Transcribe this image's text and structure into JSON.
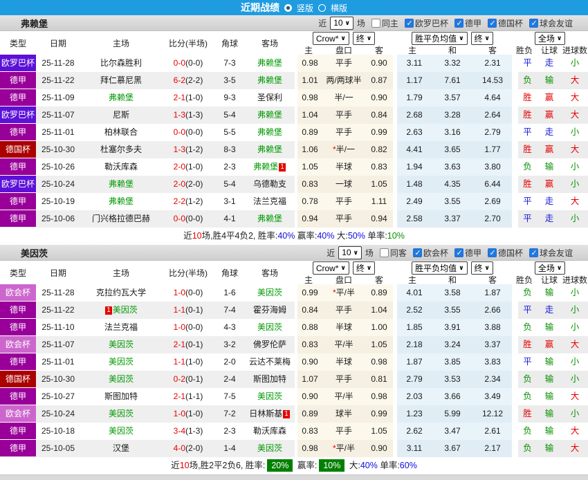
{
  "topbar": {
    "title": "近期战绩",
    "options": [
      {
        "label": "竖版",
        "selected": true
      },
      {
        "label": "横版",
        "selected": false
      }
    ]
  },
  "colors": {
    "topbar_blue": "#1f9ce0",
    "europa_league": "#5c10d8",
    "bundesliga": "#990099",
    "dfb_pokal": "#aa0000",
    "conference_league": "#cc66cc",
    "win_red": "#e60000",
    "draw_blue": "#1414dc",
    "lose_green": "#089000",
    "focus_team_green": "#009900",
    "summary_badge_green": "#008000"
  },
  "sections": [
    {
      "team": "弗赖堡",
      "filter": {
        "prefix": "近",
        "count": "10",
        "suffix": "场",
        "same": {
          "label": "同主",
          "checked": false
        },
        "competitions": [
          {
            "label": "欧罗巴杯",
            "checked": true
          },
          {
            "label": "德甲",
            "checked": true
          },
          {
            "label": "德国杯",
            "checked": true
          },
          {
            "label": "球会友谊",
            "checked": true
          }
        ]
      },
      "header": {
        "type": "类型",
        "date": "日期",
        "home": "主场",
        "score": "比分(半场)",
        "corner": "角球",
        "away": "客场",
        "odds_source": "Crow*",
        "odds_stage": "终",
        "odds_cols": [
          "主",
          "盘口",
          "客"
        ],
        "mean_source": "胜平负均值",
        "mean_stage": "终",
        "mean_cols": [
          "主",
          "和",
          "客"
        ],
        "scope": "全场",
        "result_cols": [
          "胜负",
          "让球",
          "进球数"
        ]
      },
      "rows": [
        {
          "type": "欧罗巴杯",
          "tc": "europa",
          "date": "25-11-28",
          "home": {
            "t": "比尔森胜利",
            "f": false
          },
          "score": "0-0",
          "half": "(0-0)",
          "corner": "7-3",
          "away": {
            "t": "弗赖堡",
            "f": true
          },
          "o1": "0.98",
          "hc": "平手",
          "o2": "0.90",
          "m1": "3.11",
          "m2": "3.32",
          "m3": "2.31",
          "res": [
            [
              "平",
              "b"
            ],
            [
              "走",
              "b"
            ],
            [
              "小",
              "g"
            ]
          ]
        },
        {
          "type": "德甲",
          "tc": "bundesliga",
          "date": "25-11-22",
          "home": {
            "t": "拜仁慕尼黑",
            "f": false
          },
          "score": "6-2",
          "half": "(2-2)",
          "corner": "3-5",
          "away": {
            "t": "弗赖堡",
            "f": true
          },
          "o1": "1.01",
          "hc": "两/两球半",
          "o2": "0.87",
          "m1": "1.17",
          "m2": "7.61",
          "m3": "14.53",
          "res": [
            [
              "负",
              "g"
            ],
            [
              "输",
              "g"
            ],
            [
              "大",
              "r"
            ]
          ]
        },
        {
          "type": "德甲",
          "tc": "bundesliga",
          "date": "25-11-09",
          "home": {
            "t": "弗赖堡",
            "f": true
          },
          "score": "2-1",
          "half": "(1-0)",
          "corner": "9-3",
          "away": {
            "t": "圣保利",
            "f": false
          },
          "o1": "0.98",
          "hc": "半/一",
          "o2": "0.90",
          "m1": "1.79",
          "m2": "3.57",
          "m3": "4.64",
          "res": [
            [
              "胜",
              "r"
            ],
            [
              "赢",
              "r"
            ],
            [
              "大",
              "r"
            ]
          ]
        },
        {
          "type": "欧罗巴杯",
          "tc": "europa",
          "date": "25-11-07",
          "home": {
            "t": "尼斯",
            "f": false
          },
          "score": "1-3",
          "half": "(1-3)",
          "corner": "5-4",
          "away": {
            "t": "弗赖堡",
            "f": true
          },
          "o1": "1.04",
          "hc": "平手",
          "o2": "0.84",
          "m1": "2.68",
          "m2": "3.28",
          "m3": "2.64",
          "res": [
            [
              "胜",
              "r"
            ],
            [
              "赢",
              "r"
            ],
            [
              "大",
              "r"
            ]
          ]
        },
        {
          "type": "德甲",
          "tc": "bundesliga",
          "date": "25-11-01",
          "home": {
            "t": "柏林联合",
            "f": false
          },
          "score": "0-0",
          "half": "(0-0)",
          "corner": "5-5",
          "away": {
            "t": "弗赖堡",
            "f": true
          },
          "o1": "0.89",
          "hc": "平手",
          "o2": "0.99",
          "m1": "2.63",
          "m2": "3.16",
          "m3": "2.79",
          "res": [
            [
              "平",
              "b"
            ],
            [
              "走",
              "b"
            ],
            [
              "小",
              "g"
            ]
          ]
        },
        {
          "type": "德国杯",
          "tc": "pokal",
          "date": "25-10-30",
          "home": {
            "t": "杜塞尔多夫",
            "f": false
          },
          "score": "1-3",
          "half": "(1-2)",
          "corner": "8-3",
          "away": {
            "t": "弗赖堡",
            "f": true
          },
          "o1": "1.06",
          "hc": "*半/一",
          "o2": "0.82",
          "m1": "4.41",
          "m2": "3.65",
          "m3": "1.77",
          "res": [
            [
              "胜",
              "r"
            ],
            [
              "赢",
              "r"
            ],
            [
              "大",
              "r"
            ]
          ]
        },
        {
          "type": "德甲",
          "tc": "bundesliga",
          "date": "25-10-26",
          "home": {
            "t": "勒沃库森",
            "f": false
          },
          "score": "2-0",
          "half": "(1-0)",
          "corner": "2-3",
          "away": {
            "t": "弗赖堡",
            "f": true,
            "badge": "1",
            "side": "right"
          },
          "o1": "1.05",
          "hc": "半球",
          "o2": "0.83",
          "m1": "1.94",
          "m2": "3.63",
          "m3": "3.80",
          "res": [
            [
              "负",
              "g"
            ],
            [
              "输",
              "g"
            ],
            [
              "小",
              "g"
            ]
          ]
        },
        {
          "type": "欧罗巴杯",
          "tc": "europa",
          "date": "25-10-24",
          "home": {
            "t": "弗赖堡",
            "f": true
          },
          "score": "2-0",
          "half": "(2-0)",
          "corner": "5-4",
          "away": {
            "t": "乌德勒支",
            "f": false
          },
          "o1": "0.83",
          "hc": "一球",
          "o2": "1.05",
          "m1": "1.48",
          "m2": "4.35",
          "m3": "6.44",
          "res": [
            [
              "胜",
              "r"
            ],
            [
              "赢",
              "r"
            ],
            [
              "小",
              "g"
            ]
          ]
        },
        {
          "type": "德甲",
          "tc": "bundesliga",
          "date": "25-10-19",
          "home": {
            "t": "弗赖堡",
            "f": true
          },
          "score": "2-2",
          "half": "(1-2)",
          "corner": "3-1",
          "away": {
            "t": "法兰克福",
            "f": false
          },
          "o1": "0.78",
          "hc": "平手",
          "o2": "1.11",
          "m1": "2.49",
          "m2": "3.55",
          "m3": "2.69",
          "res": [
            [
              "平",
              "b"
            ],
            [
              "走",
              "b"
            ],
            [
              "大",
              "r"
            ]
          ]
        },
        {
          "type": "德甲",
          "tc": "bundesliga",
          "date": "25-10-06",
          "home": {
            "t": "门兴格拉德巴赫",
            "f": false
          },
          "score": "0-0",
          "half": "(0-0)",
          "corner": "4-1",
          "away": {
            "t": "弗赖堡",
            "f": true
          },
          "o1": "0.94",
          "hc": "平手",
          "o2": "0.94",
          "m1": "2.58",
          "m2": "3.37",
          "m3": "2.70",
          "res": [
            [
              "平",
              "b"
            ],
            [
              "走",
              "b"
            ],
            [
              "小",
              "g"
            ]
          ]
        }
      ],
      "summary": [
        [
          "近",
          "k"
        ],
        [
          "10",
          "r"
        ],
        [
          "场,胜4平4负2, 胜率:",
          "k"
        ],
        [
          "40%",
          "b"
        ],
        [
          " 赢率:",
          "k"
        ],
        [
          "40%",
          "b"
        ],
        [
          " 大:",
          "k"
        ],
        [
          "50%",
          "b"
        ],
        [
          " 单率:",
          "k"
        ],
        [
          "10%",
          "g"
        ]
      ]
    },
    {
      "team": "美因茨",
      "filter": {
        "prefix": "近",
        "count": "10",
        "suffix": "场",
        "same": {
          "label": "同客",
          "checked": false
        },
        "competitions": [
          {
            "label": "欧会杯",
            "checked": true
          },
          {
            "label": "德甲",
            "checked": true
          },
          {
            "label": "德国杯",
            "checked": true
          },
          {
            "label": "球会友谊",
            "checked": true
          }
        ]
      },
      "header": {
        "type": "类型",
        "date": "日期",
        "home": "主场",
        "score": "比分(半场)",
        "corner": "角球",
        "away": "客场",
        "odds_source": "Crow*",
        "odds_stage": "终",
        "odds_cols": [
          "主",
          "盘口",
          "客"
        ],
        "mean_source": "胜平负均值",
        "mean_stage": "终",
        "mean_cols": [
          "主",
          "和",
          "客"
        ],
        "scope": "全场",
        "result_cols": [
          "胜负",
          "让球",
          "进球数"
        ]
      },
      "rows": [
        {
          "type": "欧会杯",
          "tc": "conference",
          "date": "25-11-28",
          "home": {
            "t": "克拉约瓦大学",
            "f": false
          },
          "score": "1-0",
          "half": "(0-0)",
          "corner": "1-6",
          "away": {
            "t": "美因茨",
            "f": true
          },
          "o1": "0.99",
          "hc": "*平/半",
          "o2": "0.89",
          "m1": "4.01",
          "m2": "3.58",
          "m3": "1.87",
          "res": [
            [
              "负",
              "g"
            ],
            [
              "输",
              "g"
            ],
            [
              "小",
              "g"
            ]
          ]
        },
        {
          "type": "德甲",
          "tc": "bundesliga",
          "date": "25-11-22",
          "home": {
            "t": "美因茨",
            "f": true,
            "badge": "1",
            "side": "left"
          },
          "score": "1-1",
          "half": "(0-1)",
          "corner": "7-4",
          "away": {
            "t": "霍芬海姆",
            "f": false
          },
          "o1": "0.84",
          "hc": "平手",
          "o2": "1.04",
          "m1": "2.52",
          "m2": "3.55",
          "m3": "2.66",
          "res": [
            [
              "平",
              "b"
            ],
            [
              "走",
              "b"
            ],
            [
              "小",
              "g"
            ]
          ]
        },
        {
          "type": "德甲",
          "tc": "bundesliga",
          "date": "25-11-10",
          "home": {
            "t": "法兰克福",
            "f": false
          },
          "score": "1-0",
          "half": "(0-0)",
          "corner": "4-3",
          "away": {
            "t": "美因茨",
            "f": true
          },
          "o1": "0.88",
          "hc": "半球",
          "o2": "1.00",
          "m1": "1.85",
          "m2": "3.91",
          "m3": "3.88",
          "res": [
            [
              "负",
              "g"
            ],
            [
              "输",
              "g"
            ],
            [
              "小",
              "g"
            ]
          ]
        },
        {
          "type": "欧会杯",
          "tc": "conference",
          "date": "25-11-07",
          "home": {
            "t": "美因茨",
            "f": true
          },
          "score": "2-1",
          "half": "(0-1)",
          "corner": "3-2",
          "away": {
            "t": "佛罗伦萨",
            "f": false
          },
          "o1": "0.83",
          "hc": "平/半",
          "o2": "1.05",
          "m1": "2.18",
          "m2": "3.24",
          "m3": "3.37",
          "res": [
            [
              "胜",
              "r"
            ],
            [
              "赢",
              "r"
            ],
            [
              "大",
              "r"
            ]
          ]
        },
        {
          "type": "德甲",
          "tc": "bundesliga",
          "date": "25-11-01",
          "home": {
            "t": "美因茨",
            "f": true
          },
          "score": "1-1",
          "half": "(1-0)",
          "corner": "2-0",
          "away": {
            "t": "云达不莱梅",
            "f": false
          },
          "o1": "0.90",
          "hc": "半球",
          "o2": "0.98",
          "m1": "1.87",
          "m2": "3.85",
          "m3": "3.83",
          "res": [
            [
              "平",
              "b"
            ],
            [
              "输",
              "g"
            ],
            [
              "小",
              "g"
            ]
          ]
        },
        {
          "type": "德国杯",
          "tc": "pokal",
          "date": "25-10-30",
          "home": {
            "t": "美因茨",
            "f": true
          },
          "score": "0-2",
          "half": "(0-1)",
          "corner": "2-4",
          "away": {
            "t": "斯图加特",
            "f": false
          },
          "o1": "1.07",
          "hc": "平手",
          "o2": "0.81",
          "m1": "2.79",
          "m2": "3.53",
          "m3": "2.34",
          "res": [
            [
              "负",
              "g"
            ],
            [
              "输",
              "g"
            ],
            [
              "小",
              "g"
            ]
          ]
        },
        {
          "type": "德甲",
          "tc": "bundesliga",
          "date": "25-10-27",
          "home": {
            "t": "斯图加特",
            "f": false
          },
          "score": "2-1",
          "half": "(1-1)",
          "corner": "7-5",
          "away": {
            "t": "美因茨",
            "f": true
          },
          "o1": "0.90",
          "hc": "平/半",
          "o2": "0.98",
          "m1": "2.03",
          "m2": "3.66",
          "m3": "3.49",
          "res": [
            [
              "负",
              "g"
            ],
            [
              "输",
              "g"
            ],
            [
              "大",
              "r"
            ]
          ]
        },
        {
          "type": "欧会杯",
          "tc": "conference",
          "date": "25-10-24",
          "home": {
            "t": "美因茨",
            "f": true
          },
          "score": "1-0",
          "half": "(1-0)",
          "corner": "7-2",
          "away": {
            "t": "日林斯基",
            "f": false,
            "badge": "1",
            "side": "right"
          },
          "o1": "0.89",
          "hc": "球半",
          "o2": "0.99",
          "m1": "1.23",
          "m2": "5.99",
          "m3": "12.12",
          "res": [
            [
              "胜",
              "r"
            ],
            [
              "输",
              "g"
            ],
            [
              "小",
              "g"
            ]
          ]
        },
        {
          "type": "德甲",
          "tc": "bundesliga",
          "date": "25-10-18",
          "home": {
            "t": "美因茨",
            "f": true
          },
          "score": "3-4",
          "half": "(1-3)",
          "corner": "2-3",
          "away": {
            "t": "勒沃库森",
            "f": false
          },
          "o1": "0.83",
          "hc": "平手",
          "o2": "1.05",
          "m1": "2.62",
          "m2": "3.47",
          "m3": "2.61",
          "res": [
            [
              "负",
              "g"
            ],
            [
              "输",
              "g"
            ],
            [
              "大",
              "r"
            ]
          ]
        },
        {
          "type": "德甲",
          "tc": "bundesliga",
          "date": "25-10-05",
          "home": {
            "t": "汉堡",
            "f": false
          },
          "score": "4-0",
          "half": "(2-0)",
          "corner": "1-4",
          "away": {
            "t": "美因茨",
            "f": true
          },
          "o1": "0.98",
          "hc": "*平/半",
          "o2": "0.90",
          "m1": "3.11",
          "m2": "3.67",
          "m3": "2.17",
          "res": [
            [
              "负",
              "g"
            ],
            [
              "输",
              "g"
            ],
            [
              "大",
              "r"
            ]
          ]
        }
      ],
      "summary": [
        [
          "近",
          "k"
        ],
        [
          "10",
          "r"
        ],
        [
          "场,胜2平2负6, 胜率:",
          "k"
        ],
        [
          "20%",
          "badge"
        ],
        [
          " 赢率:",
          "k"
        ],
        [
          "10%",
          "badge"
        ],
        [
          " 大:",
          "k"
        ],
        [
          "40%",
          "b"
        ],
        [
          " 单率:",
          "k"
        ],
        [
          "60%",
          "b"
        ]
      ]
    }
  ]
}
